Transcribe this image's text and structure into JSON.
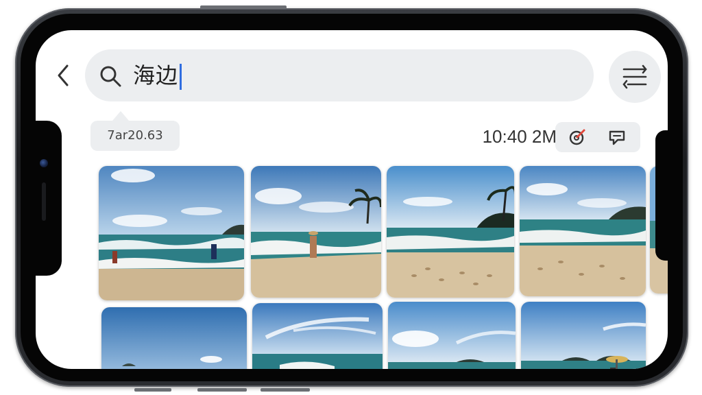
{
  "search": {
    "query": "海边"
  },
  "result_info": {
    "chip_label": "7ar20.63",
    "time_label": "10:40 2M"
  },
  "icons": {
    "back": "chevron-left-icon",
    "search": "search-icon",
    "filter": "filter-sort-icon",
    "edit": "edit-target-icon",
    "comment": "comment-icon"
  },
  "colors": {
    "caret": "#2f6de0",
    "edit_accent": "#e0463a",
    "surface": "#eceef0"
  },
  "photos": [
    {
      "subject": "beach-waves-person"
    },
    {
      "subject": "beach-palm-person-hat"
    },
    {
      "subject": "beach-palm-footprints"
    },
    {
      "subject": "beach-island-footprints"
    },
    {
      "subject": "beach-partial"
    },
    {
      "subject": "blue-sky-sea"
    },
    {
      "subject": "sky-clouds-waves"
    },
    {
      "subject": "sky-clouds-islands"
    },
    {
      "subject": "beach-umbrella-people"
    }
  ]
}
